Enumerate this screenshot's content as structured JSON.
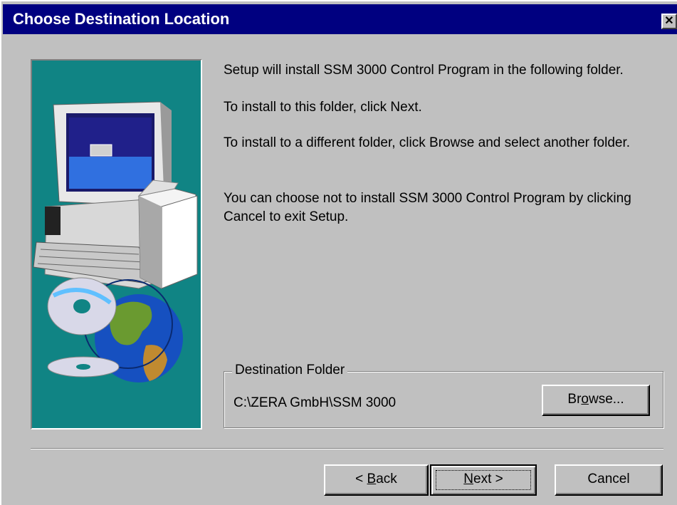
{
  "window": {
    "title": "Choose Destination Location",
    "close_glyph": "✕"
  },
  "messages": [
    "Setup will install SSM 3000 Control Program in the following folder.",
    "To install to this folder, click Next.",
    "To install to a different folder, click Browse and select another folder.",
    "You can choose not to install SSM 3000 Control Program by clicking Cancel to exit Setup."
  ],
  "destination": {
    "group_label": "Destination Folder",
    "path": "C:\\ZERA GmbH\\SSM 3000",
    "browse_pre": "Br",
    "browse_mnemonic": "o",
    "browse_post": "wse..."
  },
  "buttons": {
    "back_pre": "< ",
    "back_mnemonic": "B",
    "back_post": "ack",
    "next_mnemonic": "N",
    "next_post": "ext >",
    "cancel": "Cancel"
  },
  "colors": {
    "title_bar": "#000080",
    "art_background": "#108484",
    "dialog_face": "#c0c0c0"
  },
  "icons": [
    "computer-illustration",
    "cd-disc-icon",
    "globe-icon",
    "box-icon"
  ]
}
